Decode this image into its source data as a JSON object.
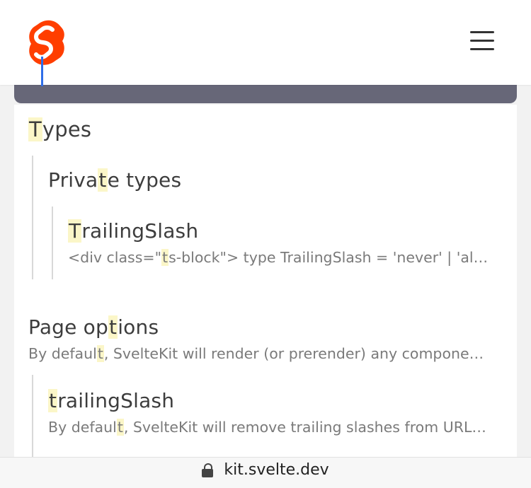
{
  "header": {
    "logo_icon": "svelte-logo-icon",
    "menu_icon": "hamburger-menu-icon",
    "brand_color": "#ff3e00"
  },
  "results": [
    {
      "level": 0,
      "title_parts": [
        {
          "hl": "T"
        },
        {
          "t": "ypes"
        }
      ]
    },
    {
      "level": 1,
      "title_parts": [
        {
          "t": "Priva"
        },
        {
          "hl": "t"
        },
        {
          "t": "e types"
        }
      ]
    },
    {
      "level": 2,
      "title_parts": [
        {
          "hl": "T"
        },
        {
          "t": "railingSlash"
        }
      ],
      "snippet_parts": [
        {
          "t": "<div class=\""
        },
        {
          "hl": "t"
        },
        {
          "t": "s-block\"> type TrailingSlash = 'never' | 'al…"
        }
      ]
    },
    {
      "level": 0,
      "title_parts": [
        {
          "t": "Page op"
        },
        {
          "hl": "t"
        },
        {
          "t": "ions"
        }
      ],
      "snippet_parts": [
        {
          "t": "By defaul"
        },
        {
          "hl": "t"
        },
        {
          "t": ", SvelteKit will render (or prerender) any compone…"
        }
      ]
    },
    {
      "level": 1,
      "title_parts": [
        {
          "hl": "t"
        },
        {
          "t": "railingSlash"
        }
      ],
      "snippet_parts": [
        {
          "t": "By defaul"
        },
        {
          "hl": "t"
        },
        {
          "t": ", SvelteKit will remove trailing slashes from URL…"
        }
      ]
    }
  ],
  "bottombar": {
    "lock_icon": "lock-icon",
    "url": "kit.svelte.dev"
  }
}
